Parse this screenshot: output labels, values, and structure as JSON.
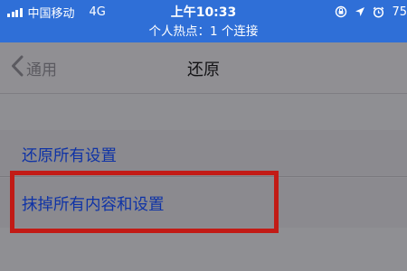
{
  "status_bar": {
    "carrier": "中国移动",
    "network": "4G",
    "time": "上午10:33",
    "battery": "75"
  },
  "hotspot_banner": "个人热点：1 个连接",
  "nav": {
    "back_label": "通用",
    "title": "还原"
  },
  "settings": {
    "items": [
      {
        "label": "还原所有设置"
      },
      {
        "label": "抹掉所有内容和设置"
      }
    ]
  },
  "colors": {
    "status_bar": "#2f6fd7",
    "link_text": "#0f33a6",
    "highlight_border": "#c21b16"
  }
}
